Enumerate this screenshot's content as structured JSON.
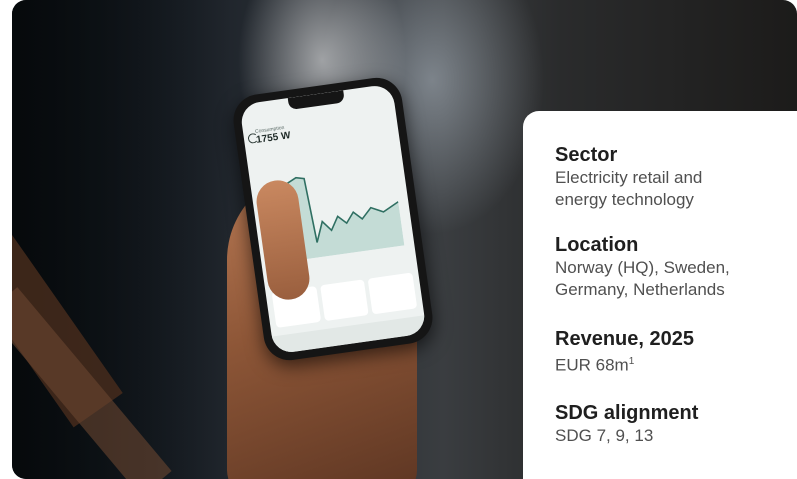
{
  "photo": {
    "phone_screen": {
      "power_label": "Consumption",
      "power_value": "1755 W"
    }
  },
  "info": {
    "sector": {
      "title": "Sector",
      "text_line1": "Electricity retail and",
      "text_line2": "energy technology"
    },
    "location": {
      "title": "Location",
      "text_line1": "Norway (HQ), Sweden,",
      "text_line2": "Germany, Netherlands"
    },
    "revenue": {
      "title": "Revenue, 2025",
      "text": "EUR 68m",
      "footnote": "1"
    },
    "sdg": {
      "title": "SDG alignment",
      "prefix": "SDG",
      "goals": "7, 9, 13"
    }
  }
}
